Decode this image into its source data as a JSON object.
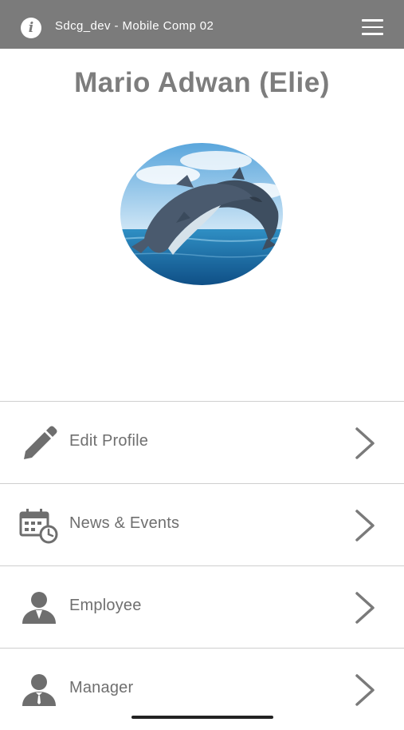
{
  "header": {
    "title": "Sdcg_dev - Mobile Comp 02",
    "info_icon": "info-icon",
    "menu_icon": "hamburger-menu-icon",
    "background": "#7b7b7b"
  },
  "profile": {
    "name": "Mario Adwan (Elie)",
    "avatar": "dolphins-photo"
  },
  "menu": [
    {
      "label": "Edit Profile",
      "icon": "pencil-icon"
    },
    {
      "label": "News & Events",
      "icon": "calendar-clock-icon"
    },
    {
      "label": "Employee",
      "icon": "employee-person-icon"
    },
    {
      "label": "Manager",
      "icon": "manager-person-icon"
    }
  ],
  "colors": {
    "text_gray": "#7d7d7d",
    "divider": "#cfcfcf"
  }
}
